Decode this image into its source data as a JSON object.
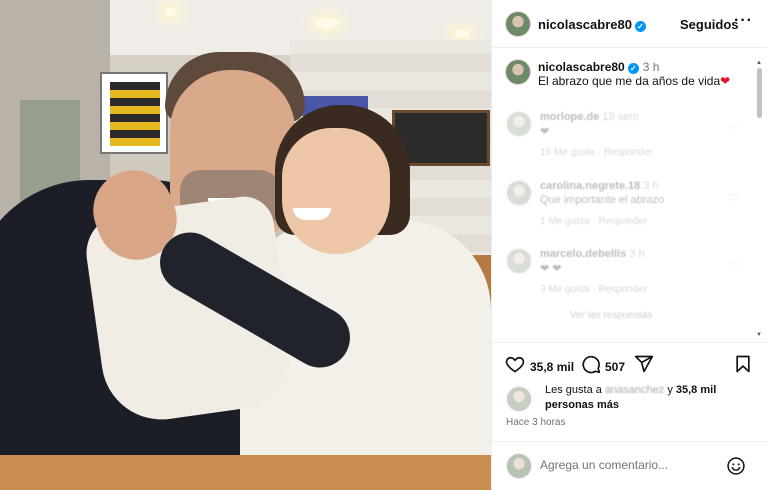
{
  "post": {
    "image_alt": "Man and girl hugging in a restaurant"
  },
  "header": {
    "username": "nicolascabre80",
    "verified_badge": "✓",
    "follow_label": "Seguidos",
    "more_label": "···"
  },
  "caption": {
    "username": "nicolascabre80",
    "time": "3 h",
    "text": "El abrazo que me da años de vida",
    "emoji": "❤"
  },
  "comments": [
    {
      "username": "morlope.de",
      "time": "19 sem",
      "text": "❤",
      "meta": "19 Me gusta · Responder"
    },
    {
      "username": "carolina.negrete.18",
      "time": "3 h",
      "text": "Que importante el abrazo",
      "meta": "1 Me gusta · Responder"
    },
    {
      "username": "marcelo.debellis",
      "time": "3 h",
      "text": "❤ ❤",
      "meta": "3 Me gusta · Responder"
    }
  ],
  "replies_label": "Ver las respuestas",
  "actions": {
    "likes_count": "35,8 mil",
    "comments_count": "507"
  },
  "likes_summary": {
    "prefix": "Les gusta a",
    "blurred_user": "anasanchez",
    "connector": "y",
    "count": "35,8 mil",
    "suffix": "personas más"
  },
  "time_ago": "Hace 3 horas",
  "add_comment": {
    "placeholder": "Agrega un comentario..."
  },
  "colors": {
    "verified": "#0095f6",
    "heart": "#e0142d",
    "muted": "#737373"
  }
}
